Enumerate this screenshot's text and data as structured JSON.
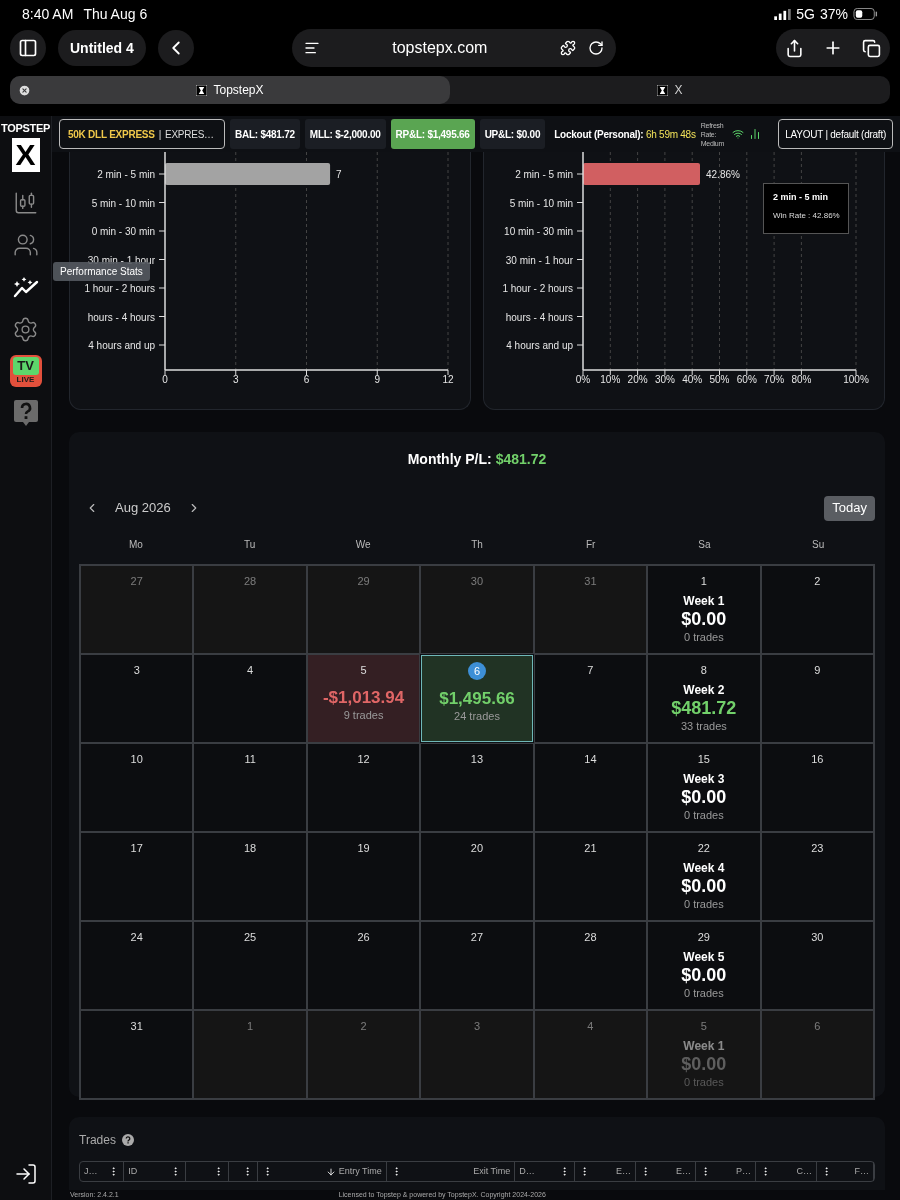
{
  "status_bar": {
    "time": "8:40 AM",
    "date": "Thu Aug 6",
    "network": "5G",
    "battery": "37%"
  },
  "browser": {
    "tab_group": "Untitled 4",
    "url": "topstepx.com",
    "tabs": [
      {
        "title": "TopstepX",
        "selected": true
      },
      {
        "title": "X",
        "selected": false
      }
    ]
  },
  "sidebar": {
    "logo": {
      "wordmark": "TOPSTEP",
      "mark": "X"
    },
    "items": [
      {
        "kind": "chart",
        "selected": false
      },
      {
        "kind": "community",
        "selected": false
      },
      {
        "kind": "stats",
        "selected": true
      },
      {
        "kind": "settings",
        "selected": false
      },
      {
        "kind": "live",
        "selected": false,
        "badge": "TV",
        "sub_badge": "LIVE"
      },
      {
        "kind": "help",
        "selected": false
      }
    ],
    "tooltip": "Performance Stats"
  },
  "header": {
    "account": {
      "name": "50K DLL EXPRESS",
      "separator": "|",
      "type": "EXPRES…"
    },
    "stats": [
      {
        "label": "BAL: $481.72",
        "highlight": false
      },
      {
        "label": "MLL: $-2,000.00",
        "highlight": false
      },
      {
        "label": "RP&L: $1,495.66",
        "highlight": true
      },
      {
        "label": "UP&L: $0.00",
        "highlight": false
      }
    ],
    "lockout": {
      "label": "Lockout (Personal):",
      "timer": "6h 59m 48s"
    },
    "refresh": "Refresh Rate: Medium",
    "layout": "LAYOUT | default (draft)"
  },
  "charts": [
    {
      "chart_data": {
        "type": "bar",
        "orientation": "horizontal",
        "categories": [
          "2 min - 5 min",
          "5 min - 10 min",
          "0 min - 30 min",
          "30 min - 1 hour",
          "1 hour - 2 hours",
          "hours - 4 hours",
          "4 hours and up"
        ],
        "values": [
          7,
          0,
          0,
          0,
          0,
          0,
          0
        ],
        "value_labels": [
          "7",
          null,
          null,
          null,
          null,
          null,
          null
        ],
        "grid": true,
        "xlim": [
          0,
          12
        ],
        "xticks": [
          0,
          3,
          6,
          9,
          12
        ]
      }
    },
    {
      "chart_data": {
        "type": "bar",
        "orientation": "horizontal",
        "categories": [
          "2 min - 5 min",
          "5 min - 10 min",
          "10 min - 30 min",
          "30 min - 1 hour",
          "1 hour - 2 hours",
          "hours - 4 hours",
          "4 hours and up"
        ],
        "values": [
          42.86,
          0,
          0,
          0,
          0,
          0,
          0
        ],
        "value_labels": [
          "42.86%",
          null,
          null,
          null,
          null,
          null,
          null
        ],
        "grid": true,
        "xlim": [
          0,
          100
        ],
        "xticks": [
          {
            "value": 0,
            "label": "0%"
          },
          {
            "value": 10,
            "label": "10%"
          },
          {
            "value": 20,
            "label": "20%"
          },
          {
            "value": 30,
            "label": "30%"
          },
          {
            "value": 40,
            "label": "40%"
          },
          {
            "value": 50,
            "label": "50%"
          },
          {
            "value": 60,
            "label": "60%"
          },
          {
            "value": 70,
            "label": "70%"
          },
          {
            "value": 80,
            "label": "80%"
          },
          {
            "value": 100,
            "label": "100%"
          }
        ]
      },
      "tooltip": {
        "title": "2 min - 5 min",
        "text": "Win Rate : 42.86%"
      }
    }
  ],
  "calendar": {
    "title": "Monthly P/L:",
    "total": "$481.72",
    "month": "Aug 2026",
    "today_button": "Today",
    "weekdays": [
      "Mo",
      "Tu",
      "We",
      "Th",
      "Fr",
      "Sa",
      "Su"
    ],
    "weeks": [
      [
        {
          "kind": "day",
          "day": "27",
          "in_month": false,
          "today": false
        },
        {
          "kind": "day",
          "day": "28",
          "in_month": false,
          "today": false
        },
        {
          "kind": "day",
          "day": "29",
          "in_month": false,
          "today": false
        },
        {
          "kind": "day",
          "day": "30",
          "in_month": false,
          "today": false
        },
        {
          "kind": "day",
          "day": "31",
          "in_month": false,
          "today": false
        },
        {
          "kind": "week",
          "day": "1",
          "in_month": true,
          "today": false,
          "week": "Week 1",
          "pnl": "$0.00",
          "trades": "0 trades",
          "color": "#ffffff"
        },
        {
          "kind": "day",
          "day": "2",
          "in_month": true,
          "today": false
        }
      ],
      [
        {
          "kind": "day",
          "day": "3",
          "in_month": true,
          "today": false
        },
        {
          "kind": "day",
          "day": "4",
          "in_month": true,
          "today": false
        },
        {
          "kind": "day",
          "day": "5",
          "in_month": true,
          "today": false,
          "pnl": "-$1,013.94",
          "trades": "9 trades",
          "color": "#e06666"
        },
        {
          "kind": "day",
          "day": "6",
          "in_month": true,
          "today": true,
          "pnl": "$1,495.66",
          "trades": "24 trades",
          "color": "#72d06a"
        },
        {
          "kind": "day",
          "day": "7",
          "in_month": true,
          "today": false
        },
        {
          "kind": "week",
          "day": "8",
          "in_month": true,
          "today": false,
          "week": "Week 2",
          "pnl": "$481.72",
          "trades": "33 trades",
          "color": "#72d06a"
        },
        {
          "kind": "day",
          "day": "9",
          "in_month": true,
          "today": false
        }
      ],
      [
        {
          "kind": "day",
          "day": "10",
          "in_month": true,
          "today": false
        },
        {
          "kind": "day",
          "day": "11",
          "in_month": true,
          "today": false
        },
        {
          "kind": "day",
          "day": "12",
          "in_month": true,
          "today": false
        },
        {
          "kind": "day",
          "day": "13",
          "in_month": true,
          "today": false
        },
        {
          "kind": "day",
          "day": "14",
          "in_month": true,
          "today": false
        },
        {
          "kind": "week",
          "day": "15",
          "in_month": true,
          "today": false,
          "week": "Week 3",
          "pnl": "$0.00",
          "trades": "0 trades",
          "color": "#ffffff"
        },
        {
          "kind": "day",
          "day": "16",
          "in_month": true,
          "today": false
        }
      ],
      [
        {
          "kind": "day",
          "day": "17",
          "in_month": true,
          "today": false
        },
        {
          "kind": "day",
          "day": "18",
          "in_month": true,
          "today": false
        },
        {
          "kind": "day",
          "day": "19",
          "in_month": true,
          "today": false
        },
        {
          "kind": "day",
          "day": "20",
          "in_month": true,
          "today": false
        },
        {
          "kind": "day",
          "day": "21",
          "in_month": true,
          "today": false
        },
        {
          "kind": "week",
          "day": "22",
          "in_month": true,
          "today": false,
          "week": "Week 4",
          "pnl": "$0.00",
          "trades": "0 trades",
          "color": "#ffffff"
        },
        {
          "kind": "day",
          "day": "23",
          "in_month": true,
          "today": false
        }
      ],
      [
        {
          "kind": "day",
          "day": "24",
          "in_month": true,
          "today": false
        },
        {
          "kind": "day",
          "day": "25",
          "in_month": true,
          "today": false
        },
        {
          "kind": "day",
          "day": "26",
          "in_month": true,
          "today": false
        },
        {
          "kind": "day",
          "day": "27",
          "in_month": true,
          "today": false
        },
        {
          "kind": "day",
          "day": "28",
          "in_month": true,
          "today": false
        },
        {
          "kind": "week",
          "day": "29",
          "in_month": true,
          "today": false,
          "week": "Week 5",
          "pnl": "$0.00",
          "trades": "0 trades",
          "color": "#ffffff"
        },
        {
          "kind": "day",
          "day": "30",
          "in_month": true,
          "today": false
        }
      ],
      [
        {
          "kind": "day",
          "day": "31",
          "in_month": true,
          "today": false
        },
        {
          "kind": "day",
          "day": "1",
          "in_month": false,
          "today": false
        },
        {
          "kind": "day",
          "day": "2",
          "in_month": false,
          "today": false
        },
        {
          "kind": "day",
          "day": "3",
          "in_month": false,
          "today": false
        },
        {
          "kind": "day",
          "day": "4",
          "in_month": false,
          "today": false
        },
        {
          "kind": "week",
          "day": "5",
          "in_month": false,
          "today": false,
          "week": "Week 1",
          "pnl": "$0.00",
          "trades": "0 trades",
          "color": "#5e5e5e"
        },
        {
          "kind": "day",
          "day": "6",
          "in_month": false,
          "today": false
        }
      ]
    ]
  },
  "trades": {
    "title": "Trades",
    "columns": [
      {
        "label": "J…",
        "sorted": false
      },
      {
        "label": "ID",
        "sorted": false
      },
      {
        "sorted": false
      },
      {
        "sorted": false
      },
      {
        "label": "Entry Time",
        "sorted": true
      },
      {
        "label": "Exit Time",
        "sorted": false
      },
      {
        "label": "D…",
        "sorted": false
      },
      {
        "label": "E…",
        "sorted": false
      },
      {
        "label": "E…",
        "sorted": false
      },
      {
        "label": "P…",
        "sorted": false
      },
      {
        "label": "C…",
        "sorted": false
      },
      {
        "label": "F…",
        "sorted": false
      }
    ]
  },
  "footer": {
    "version": "Version: 2.4.2.1",
    "license": "Licensed to Topstep & powered by TopstepX. Copyright 2024-2026"
  }
}
